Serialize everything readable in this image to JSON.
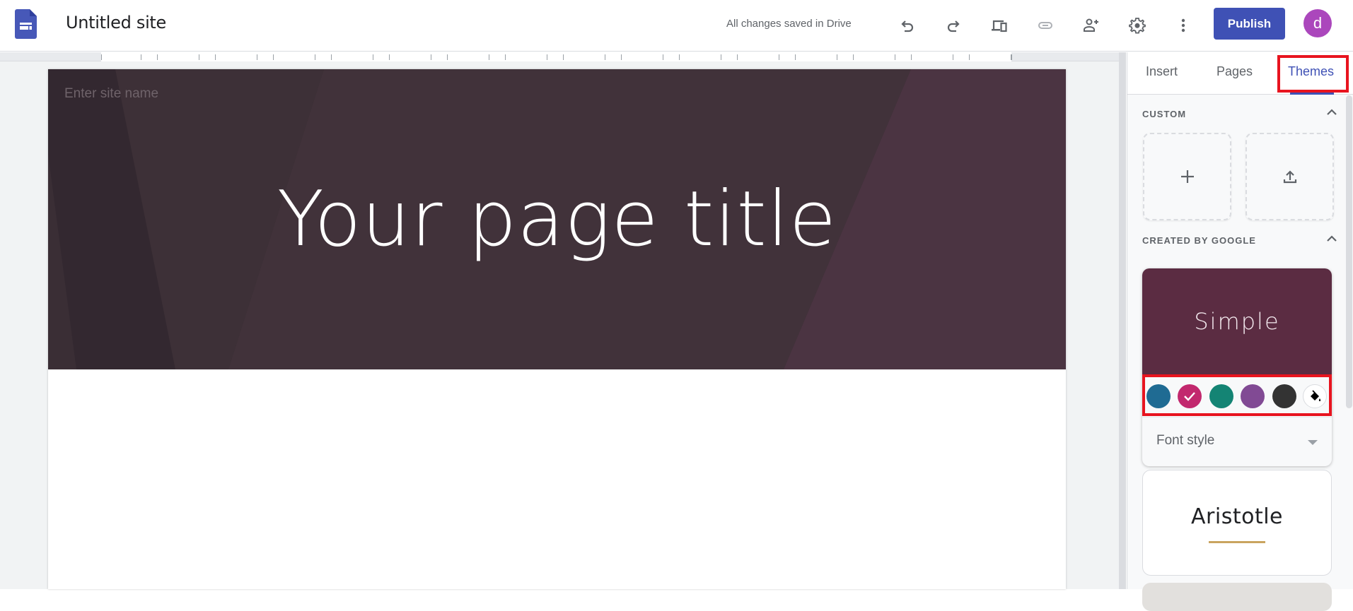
{
  "app": {
    "title": "Untitled site",
    "save_status": "All changes saved in Drive",
    "logo_icon": "google-sites-logo",
    "brand_color": "#3f51b5"
  },
  "toolbar": {
    "undo_icon": "undo-icon",
    "redo_icon": "redo-icon",
    "preview_icon": "devices-preview-icon",
    "link_icon": "link-icon",
    "share_icon": "person-add-icon",
    "settings_icon": "gear-icon",
    "more_icon": "more-vertical-icon",
    "publish_label": "Publish",
    "avatar_initial": "d",
    "avatar_color": "#ab47bc"
  },
  "canvas": {
    "site_name_placeholder": "Enter site name",
    "page_title": "Your page title",
    "header_color": "#3a2c33"
  },
  "panel": {
    "tabs": [
      {
        "label": "Insert",
        "active": false
      },
      {
        "label": "Pages",
        "active": false
      },
      {
        "label": "Themes",
        "active": true
      }
    ],
    "custom_section": {
      "label": "CUSTOM",
      "tiles": [
        {
          "icon": "plus-icon",
          "action": "add-custom-theme"
        },
        {
          "icon": "upload-icon",
          "action": "upload-theme"
        }
      ]
    },
    "google_section": {
      "label": "CREATED BY GOOGLE"
    },
    "themes": [
      {
        "name": "Simple",
        "preview_color": "#5b2c42",
        "selected": true,
        "swatches": [
          {
            "color": "#1f6b93",
            "selected": false
          },
          {
            "color": "#c2286e",
            "selected": true
          },
          {
            "color": "#148474",
            "selected": false
          },
          {
            "color": "#814a94",
            "selected": false
          },
          {
            "color": "#333333",
            "selected": false
          }
        ],
        "custom_color_icon": "paint-bucket-icon",
        "font_style_label": "Font style"
      },
      {
        "name": "Aristotle",
        "accent_color": "#c9a45f"
      }
    ]
  }
}
